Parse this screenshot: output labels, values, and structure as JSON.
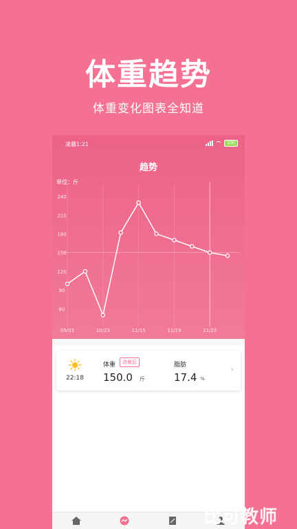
{
  "hero": {
    "title": "体重趋势",
    "subtitle": "体重变化图表全知道"
  },
  "status_bar": {
    "time": "凌晨1:21",
    "battery": "100"
  },
  "page": {
    "title": "趋势",
    "unit_label": "单位：斤"
  },
  "chart_data": {
    "type": "line",
    "y_ticks": [
      60,
      90,
      120,
      150,
      180,
      210,
      240
    ],
    "x_ticks": [
      "09/03",
      "10/23",
      "11/15",
      "11/19",
      "11/23"
    ],
    "x_positions": [
      0,
      2,
      4,
      6,
      8
    ],
    "points": [
      {
        "x": 0,
        "y": 100
      },
      {
        "x": 1,
        "y": 120
      },
      {
        "x": 2,
        "y": 50
      },
      {
        "x": 3,
        "y": 182
      },
      {
        "x": 4,
        "y": 230
      },
      {
        "x": 5,
        "y": 180
      },
      {
        "x": 6,
        "y": 170
      },
      {
        "x": 7,
        "y": 160
      },
      {
        "x": 8,
        "y": 150
      },
      {
        "x": 9,
        "y": 145
      }
    ],
    "ylim": [
      45,
      250
    ],
    "xlim": [
      0,
      9.5
    ],
    "highlight_x": 8,
    "reference_y": 150,
    "colors": {
      "line": "#ffffff",
      "grid": "#f9a6bb"
    }
  },
  "record": {
    "time": "22:18",
    "weight_label": "体重",
    "tag": "进餐后",
    "weight_value": "150.0",
    "weight_unit": "斤",
    "fat_label": "脂肪",
    "fat_value": "17.4",
    "fat_unit": "%",
    "icon": "sun-icon"
  },
  "tabs": [
    "home-icon",
    "trend-icon",
    "report-icon",
    "profile-icon"
  ],
  "watermark": "比可教师",
  "colors": {
    "background": "#f47193",
    "accent": "#f47193",
    "sun": "#f8c22a"
  }
}
